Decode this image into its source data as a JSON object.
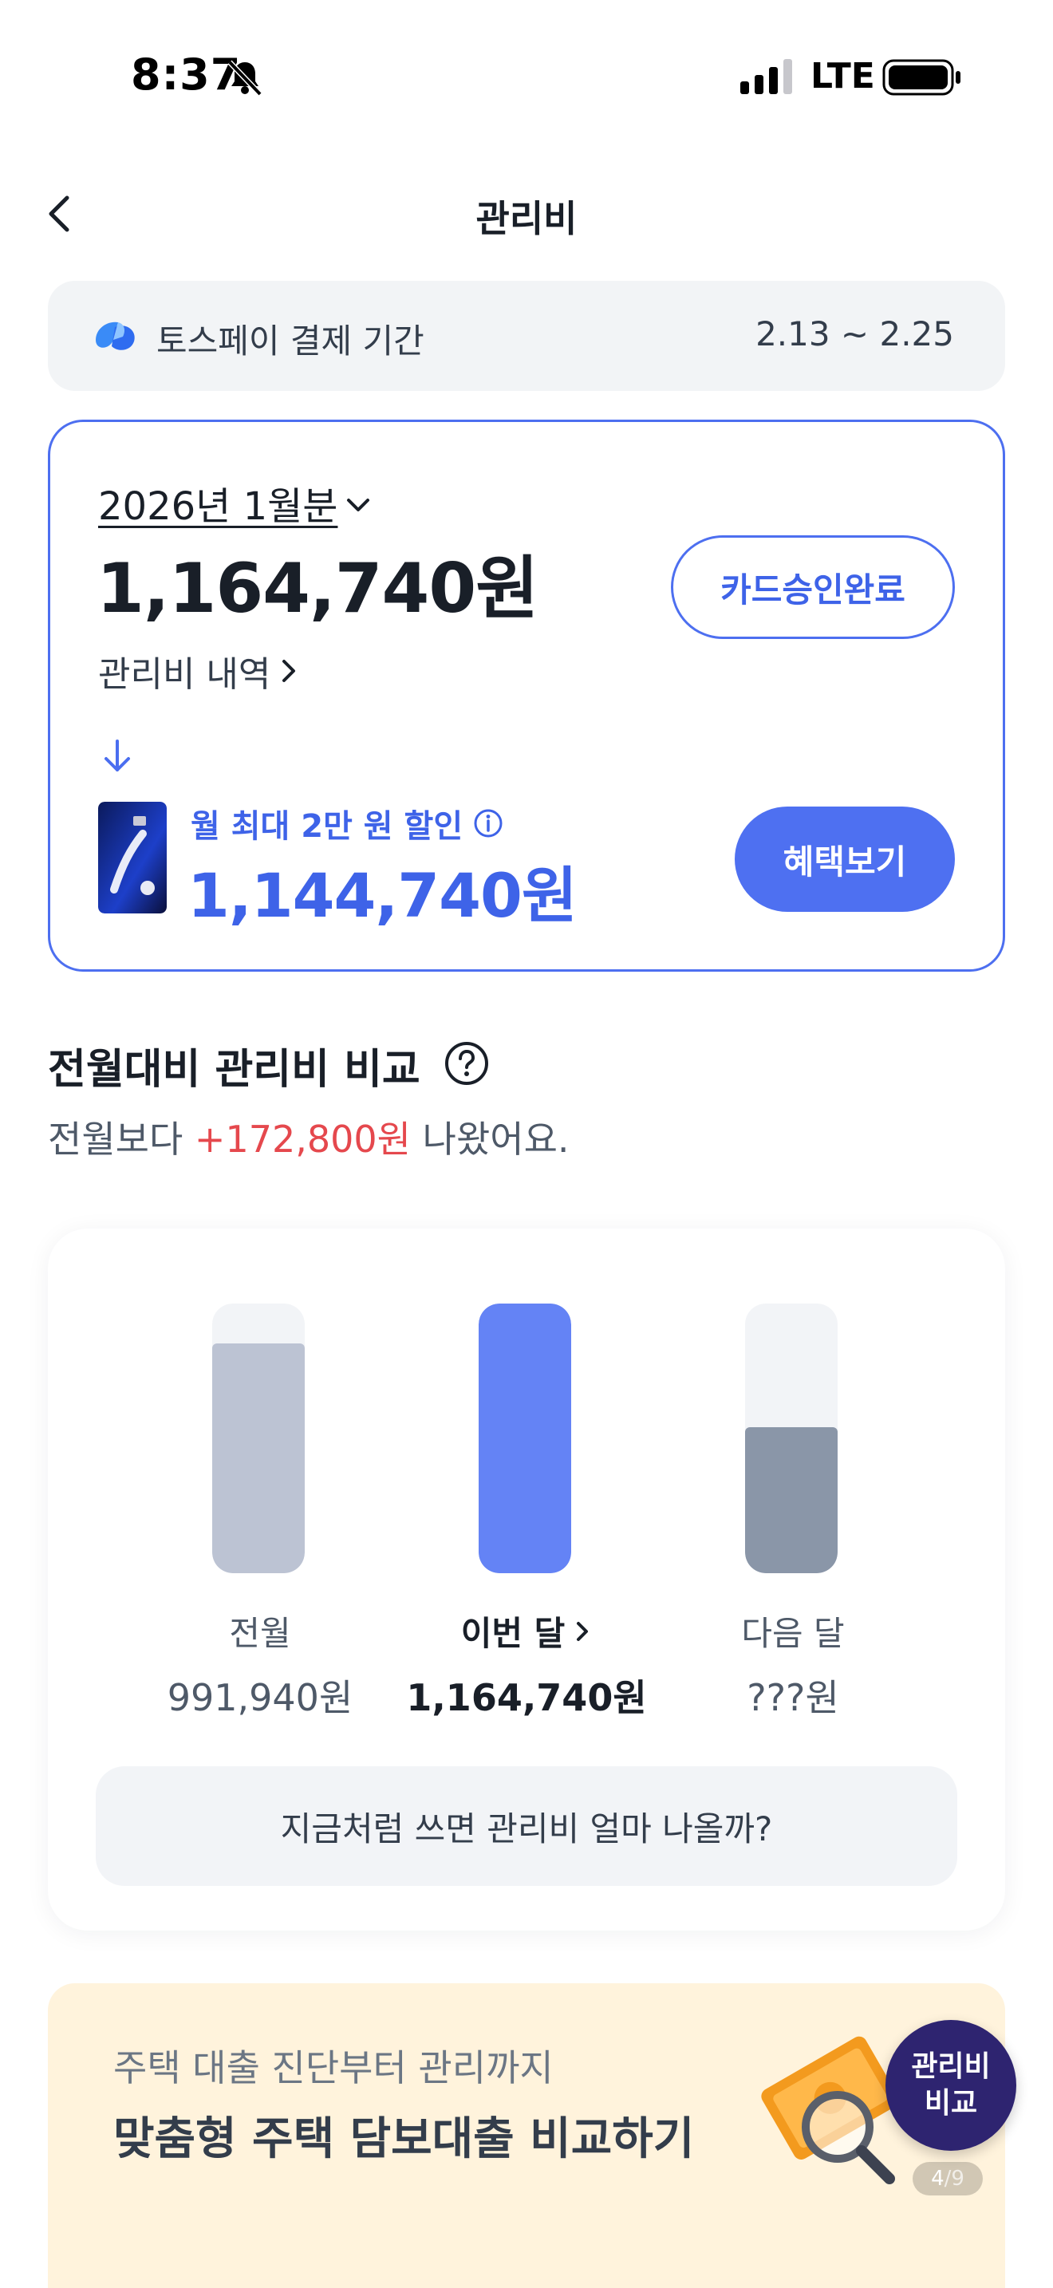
{
  "status_bar": {
    "time": "8:37",
    "network": "LTE"
  },
  "nav": {
    "title": "관리비"
  },
  "pay_period": {
    "label": "토스페이 결제 기간",
    "dates": "2.13 ~ 2.25"
  },
  "bill": {
    "month": "2026년 1월분",
    "amount": "1,164,740원",
    "detail_link": "관리비 내역",
    "status_button": "카드승인완료",
    "discount_label": "월 최대 2만 원 할인",
    "discounted_amount": "1,144,740원",
    "benefit_button": "혜택보기"
  },
  "comparison": {
    "title": "전월대비 관리비 비교",
    "summary_prefix": "전월보다 ",
    "summary_diff": "+172,800원",
    "summary_suffix": " 나왔어요.",
    "forecast_button": "지금처럼 쓰면 관리비 얼마 나올까?",
    "highlight_color": "#e5484d"
  },
  "chart_data": {
    "type": "bar",
    "categories": [
      "전월",
      "이번 달",
      "다음 달"
    ],
    "values": [
      991940,
      1164740,
      null
    ],
    "value_labels": [
      "991,940원",
      "1,164,740원",
      "???원"
    ],
    "placeholder_fill": [
      null,
      null,
      0.54
    ],
    "colors": [
      "#bcc3d3",
      "#6483f5",
      "#8a96a8"
    ],
    "ylim": [
      0,
      1164740
    ]
  },
  "ad": {
    "subtitle": "주택 대출 진단부터 관리까지",
    "title": "맞춤형 주택 담보대출 비교하기"
  },
  "floating_button": {
    "line1": "관리비",
    "line2": "비교"
  },
  "pager": {
    "current": "4",
    "total": "/9"
  }
}
